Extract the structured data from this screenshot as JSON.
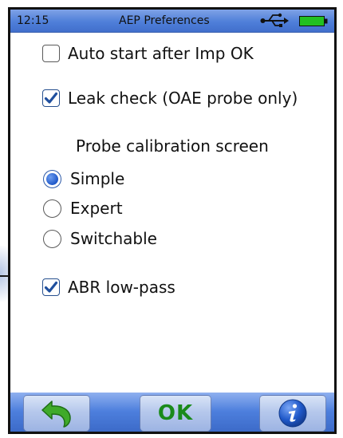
{
  "status_bar": {
    "time": "12:15",
    "title": "AEP Preferences",
    "usb_icon": "usb-icon",
    "battery_icon": "battery-icon",
    "colors": {
      "bar": "#4f7fd9",
      "battery": "#22c022"
    }
  },
  "options": {
    "auto_start": {
      "label": "Auto start after Imp OK",
      "checked": false
    },
    "leak_check": {
      "label": "Leak check (OAE probe only)",
      "checked": true
    },
    "probe_calibration": {
      "heading": "Probe calibration screen",
      "choices": [
        {
          "label": "Simple",
          "selected": true
        },
        {
          "label": "Expert",
          "selected": false
        },
        {
          "label": "Switchable",
          "selected": false
        }
      ]
    },
    "abr_low_pass": {
      "label": "ABR low-pass",
      "checked": true
    }
  },
  "bottom_bar": {
    "back_icon": "back-arrow-icon",
    "ok_label": "OK",
    "info_icon": "info-icon",
    "colors": {
      "ok": "#1a8a1a",
      "back_arrow": "#3faa2a",
      "info": "#1f58c9"
    }
  }
}
